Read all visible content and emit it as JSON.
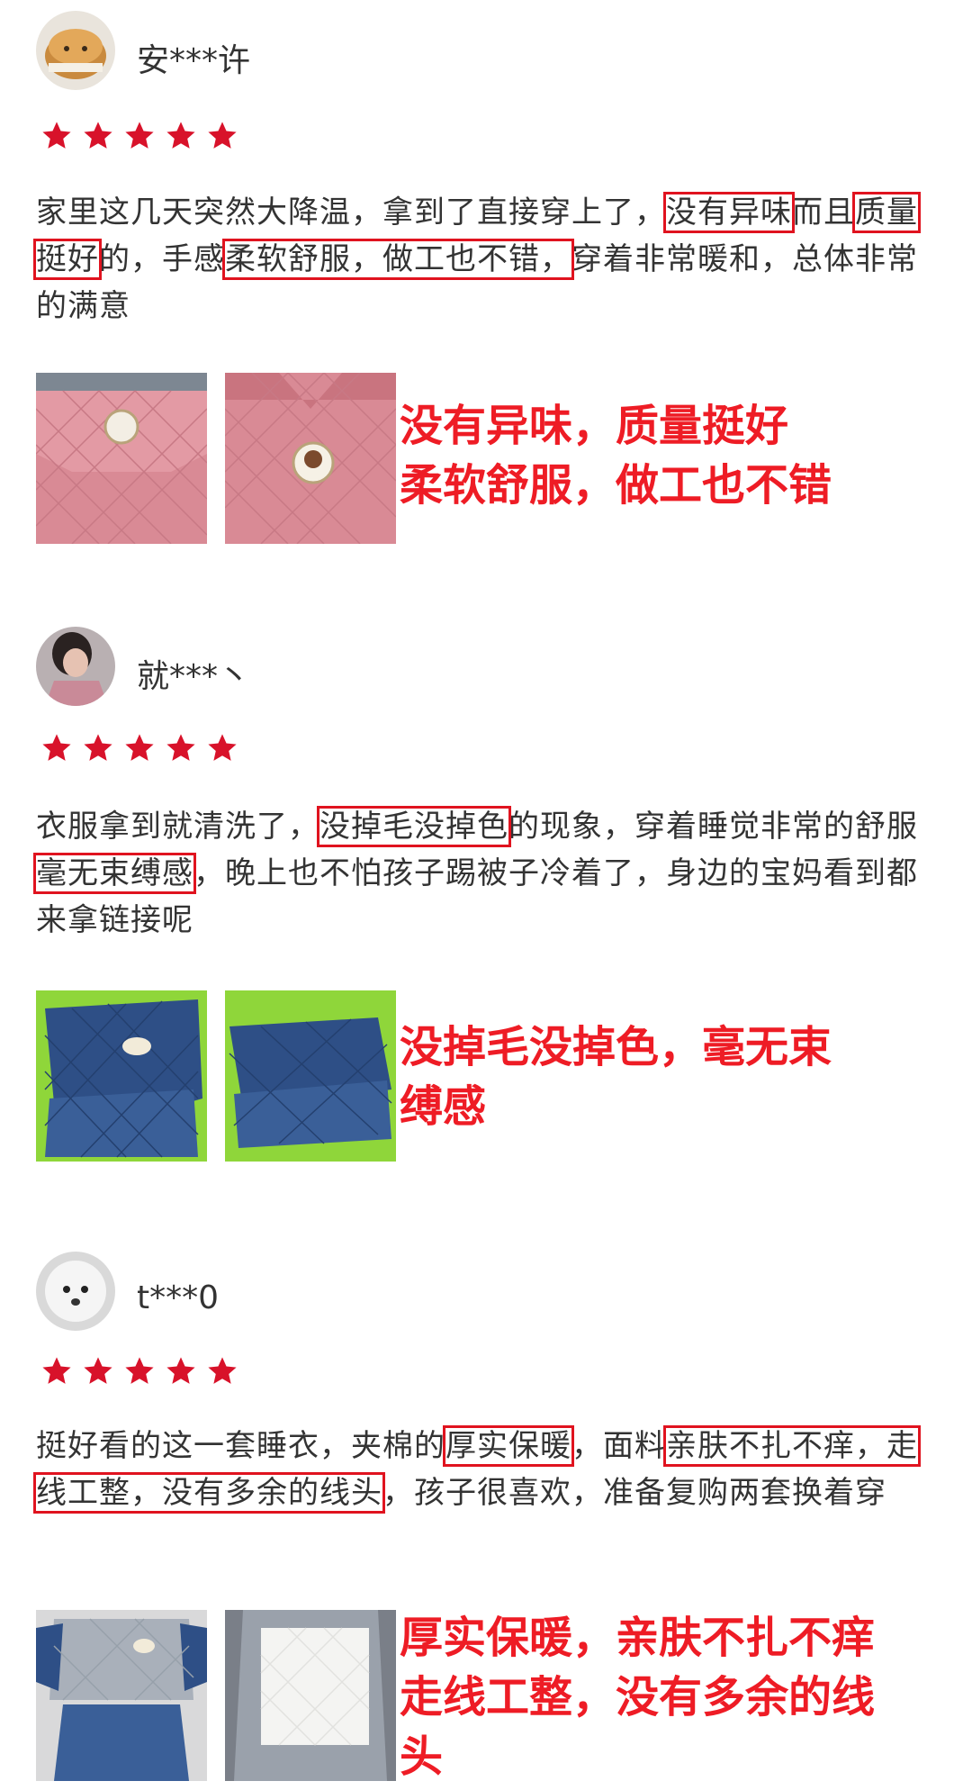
{
  "reviews": [
    {
      "username": "安***许",
      "rating": 5,
      "text_parts": [
        "家里这几天突然大降温，拿到了直接穿上了，",
        "没有异味",
        "而且",
        "质量挺好",
        "的，手感",
        "柔软舒服，做工也不错，",
        "穿着非常暖和，总体非常的满意"
      ],
      "summary_lines": [
        "没有异味，质量挺好",
        "柔软舒服，做工也不错"
      ]
    },
    {
      "username": "就***丶",
      "rating": 5,
      "text_parts": [
        "衣服拿到就清洗了，",
        "没掉毛没掉色",
        "的现象，穿着睡觉非常的舒服",
        "毫无束缚感",
        "，晚上也不怕孩子踢被子冷着了，身边的宝妈看到都来拿链接呢"
      ],
      "summary_lines": [
        "没掉毛没掉色，毫无束",
        "缚感"
      ]
    },
    {
      "username": "t***0",
      "rating": 5,
      "text_parts": [
        "挺好看的这一套睡衣，夹棉的",
        "厚实保暖",
        "，面料",
        "亲肤不扎不痒，走线工整，没有多余的线头",
        "，孩子很喜欢，准备复购两套换着穿"
      ],
      "summary_lines": [
        "厚实保暖，亲肤不扎不痒",
        "走线工整，没有多余的线",
        "头"
      ]
    }
  ],
  "colors": {
    "star": "#d8122a",
    "highlight_box": "#e0131f",
    "summary_text": "#ee1c25",
    "pink_fabric": "#d98a95",
    "navy_fabric": "#2e4f86",
    "green_table": "#8fd63a"
  },
  "icons": {
    "star": "star-icon",
    "avatar": "user-avatar"
  }
}
